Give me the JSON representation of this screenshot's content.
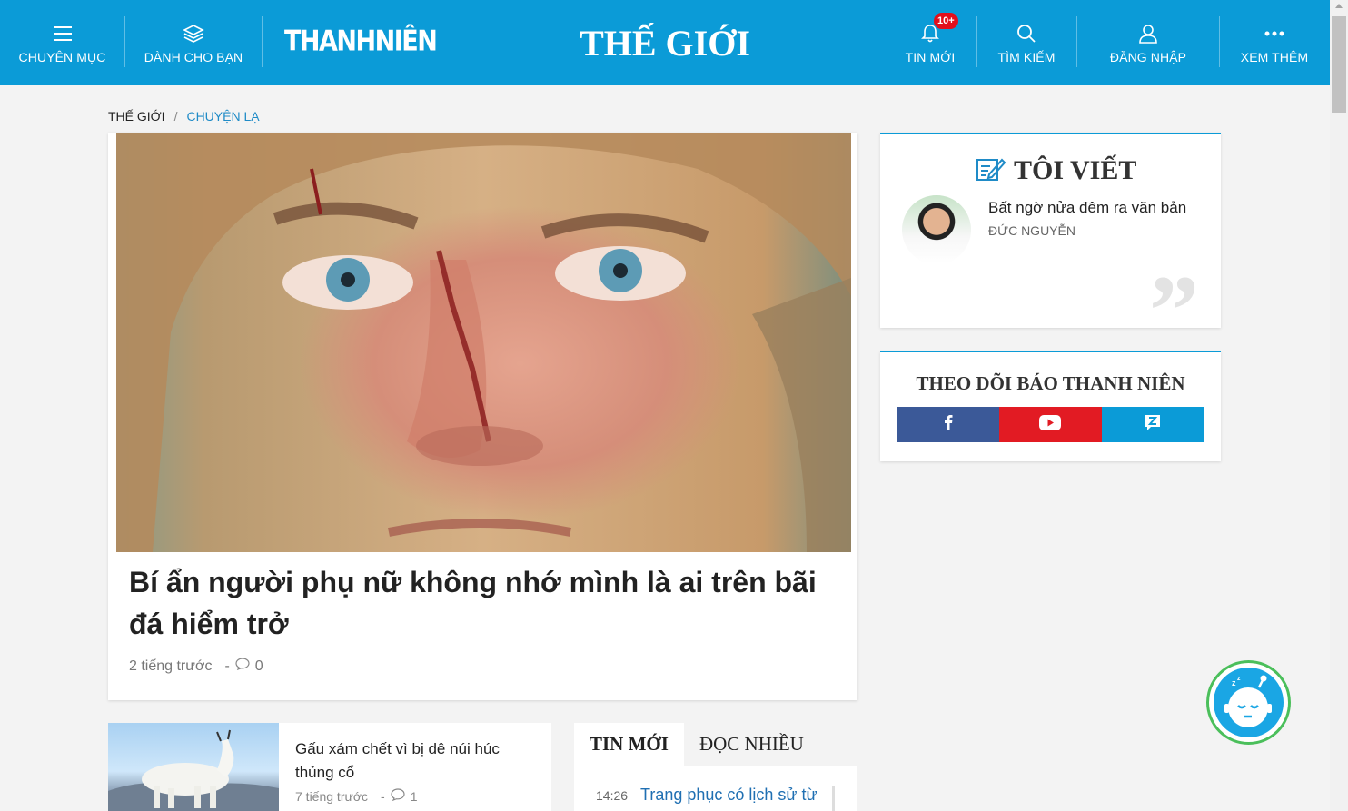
{
  "header": {
    "menu_label": "CHUYÊN MỤC",
    "for_you_label": "DÀNH CHO BẠN",
    "logo_text": "THANHNIÊN",
    "section_title": "THẾ GIỚI",
    "news_label": "TIN MỚI",
    "news_badge": "10+",
    "search_label": "TÌM KIẾM",
    "login_label": "ĐĂNG NHẬP",
    "more_label": "XEM THÊM"
  },
  "breadcrumb": {
    "root": "THẾ GIỚI",
    "divider": "/",
    "current": "CHUYỆN LẠ"
  },
  "main_article": {
    "title": "Bí ẩn người phụ nữ không nhớ mình là ai trên bãi đá hiểm trở",
    "time": "2 tiếng trước",
    "separator": "-",
    "comments": "0"
  },
  "toi_viet": {
    "title": "TÔI VIẾT",
    "headline": "Bất ngờ nửa đêm ra văn bản",
    "author": "ĐỨC NGUYỄN",
    "quote": "”"
  },
  "follow": {
    "title": "THEO DÕI BÁO THANH NIÊN",
    "facebook_icon": "facebook-icon",
    "youtube_icon": "youtube-icon",
    "zalo_icon": "zalo-icon"
  },
  "sub_article": {
    "title": "Gấu xám chết vì bị dê núi húc thủng cổ",
    "time": "7 tiếng trước",
    "separator": "-",
    "comments": "1"
  },
  "tabs": {
    "tab1": "TIN MỚI",
    "tab2": "ĐỌC NHIỀU",
    "items": [
      {
        "time": "14:26",
        "title": "Trang phục có lịch sử từ"
      }
    ]
  },
  "colors": {
    "header_bg": "#0b9bd7",
    "link": "#1f8bc7",
    "facebook": "#3b5998",
    "youtube": "#e21b23",
    "zalo": "#0b9bd7",
    "badge": "#e30f1b"
  }
}
